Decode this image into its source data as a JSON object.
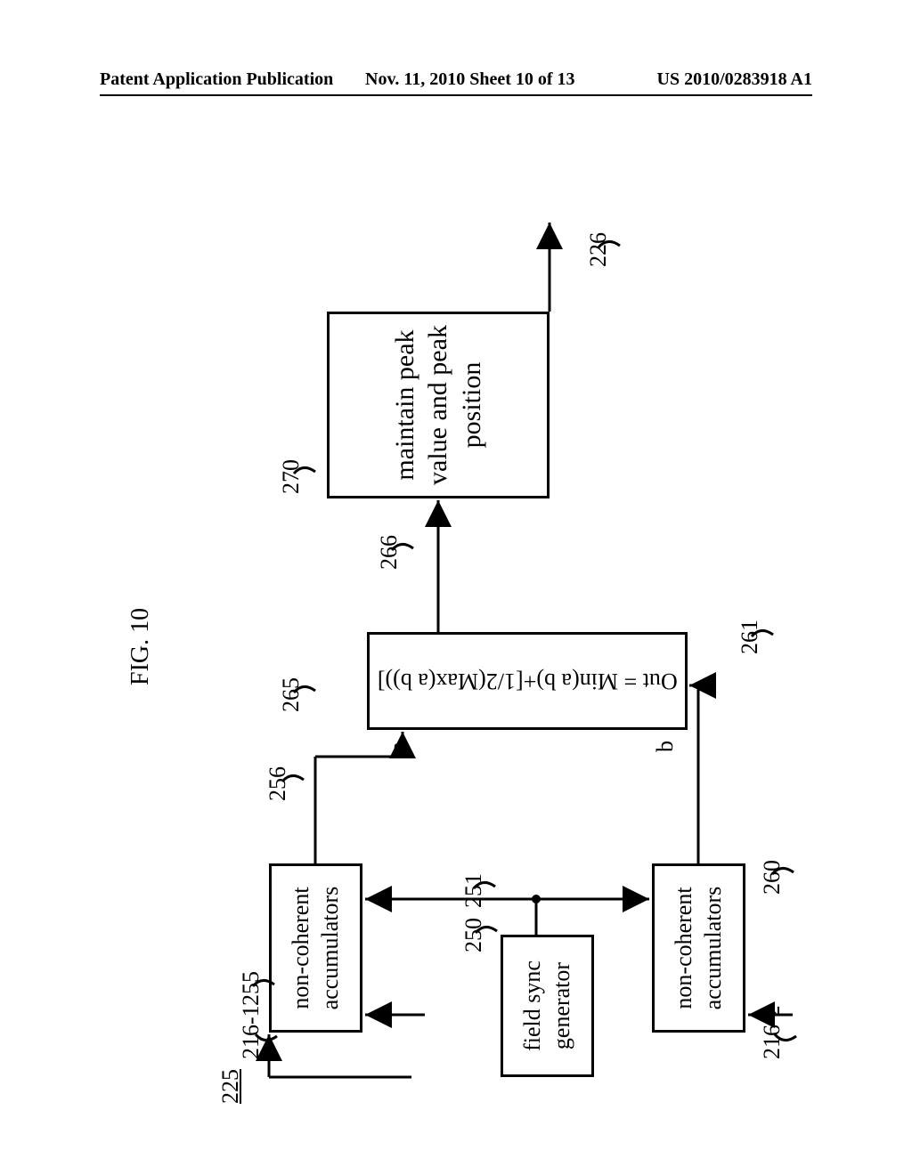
{
  "header": {
    "left": "Patent Application Publication",
    "center": "Nov. 11, 2010  Sheet 10 of 13",
    "right": "US 2010/0283918 A1"
  },
  "figure": {
    "caption": "FIG. 10",
    "frame_ref": "225"
  },
  "blocks": {
    "field_sync": {
      "text": "field sync generator",
      "ref": "250"
    },
    "accum_top": {
      "text": "non-coherent accumulators",
      "ref": "255"
    },
    "accum_bot": {
      "text": "non-coherent accumulators",
      "ref": "260"
    },
    "combiner": {
      "text": "Out = Min(a b)+[1/2(Max(a b))]",
      "ref": "265",
      "in_a": "a",
      "in_b": "b"
    },
    "peak": {
      "text": "maintain peak value and peak position",
      "ref": "270"
    }
  },
  "signals": {
    "in_top": "216-1",
    "in_bot": "216-2",
    "fs_out": "251",
    "a_out": "256",
    "b_out": "261",
    "c_out": "266",
    "final": "226"
  }
}
